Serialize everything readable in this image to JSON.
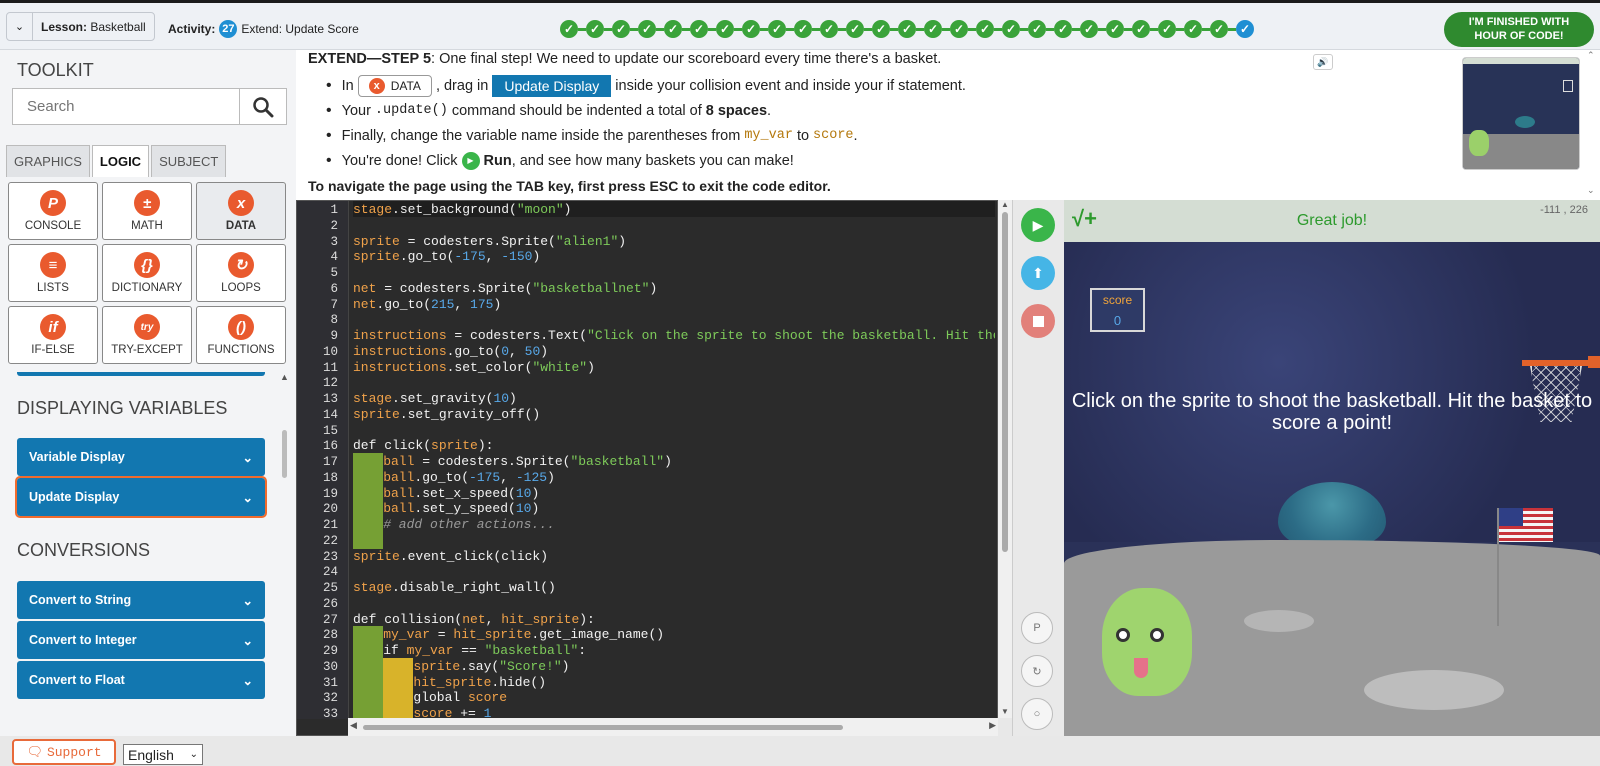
{
  "topbar": {
    "lesson_label": "Lesson:",
    "lesson_value": "Basketball",
    "activity_label": "Activity:",
    "activity_number": "27",
    "activity_title": "Extend: Update Score",
    "progress_completed": 26,
    "progress_current": 27,
    "finish_line1": "I'M FINISHED WITH",
    "finish_line2": "HOUR OF CODE!"
  },
  "toolkit": {
    "title": "TOOLKIT",
    "search_placeholder": "Search",
    "tabs": [
      "GRAPHICS",
      "LOGIC",
      "SUBJECT"
    ],
    "active_tab": "LOGIC",
    "categories": [
      {
        "label": "CONSOLE",
        "glyph": "P",
        "icon": "console-icon"
      },
      {
        "label": "MATH",
        "glyph": "±",
        "icon": "math-icon"
      },
      {
        "label": "DATA",
        "glyph": "x",
        "icon": "data-icon"
      },
      {
        "label": "LISTS",
        "glyph": "≡",
        "icon": "lists-icon"
      },
      {
        "label": "DICTIONARY",
        "glyph": "{}",
        "icon": "dictionary-icon"
      },
      {
        "label": "LOOPS",
        "glyph": "↻",
        "icon": "loops-icon"
      },
      {
        "label": "IF-ELSE",
        "glyph": "if",
        "icon": "if-else-icon"
      },
      {
        "label": "TRY-EXCEPT",
        "glyph": "try",
        "icon": "try-except-icon"
      },
      {
        "label": "FUNCTIONS",
        "glyph": "()",
        "icon": "functions-icon"
      }
    ],
    "active_category": "DATA",
    "section_displaying": "DISPLAYING VARIABLES",
    "block_variable_display": "Variable Display",
    "block_update_display": "Update Display",
    "section_conversions": "CONVERSIONS",
    "block_convert_string": "Convert to String",
    "block_convert_integer": "Convert to Integer",
    "block_convert_float": "Convert to Float"
  },
  "instructions": {
    "heading_bold": "EXTEND—STEP 5",
    "heading_rest": ": One final step! We need to update our scoreboard every time there's a basket.",
    "b1_pre": "In",
    "b1_chip": "DATA",
    "b1_mid": ", drag in",
    "b1_button": "Update Display",
    "b1_post": "inside your collision event and inside your if statement.",
    "b2_pre": "Your",
    "b2_code": ".update()",
    "b2_mid": "command should be indented a total of",
    "b2_bold": "8 spaces",
    "b2_post": ".",
    "b3_pre": "Finally, change the variable name inside the parentheses from",
    "b3_code1": "my_var",
    "b3_mid": "to",
    "b3_code2": "score",
    "b3_post": ".",
    "b4_pre": "You're done! Click",
    "b4_bold": "Run",
    "b4_post": ", and see how many baskets you can make!",
    "nav_note": "To navigate the page using the TAB key, first press ESC to exit the code editor."
  },
  "editor": {
    "lines": [
      "stage.set_background(\"moon\")",
      "",
      "sprite = codesters.Sprite(\"alien1\")",
      "sprite.go_to(-175, -150)",
      "",
      "net = codesters.Sprite(\"basketballnet\")",
      "net.go_to(215, 175)",
      "",
      "instructions = codesters.Text(\"Click on the sprite to shoot the basketball. Hit the",
      "instructions.go_to(0, 50)",
      "instructions.set_color(\"white\")",
      "",
      "stage.set_gravity(10)",
      "sprite.set_gravity_off()",
      "",
      "def click(sprite):",
      "    ball = codesters.Sprite(\"basketball\")",
      "    ball.go_to(-175, -125)",
      "    ball.set_x_speed(10)",
      "    ball.set_y_speed(10)",
      "    # add other actions...",
      "",
      "sprite.event_click(click)",
      "",
      "stage.disable_right_wall()",
      "",
      "def collision(net, hit_sprite):",
      "    my_var = hit_sprite.get_image_name()",
      "    if my_var == \"basketball\":",
      "        sprite.say(\"Score!\")",
      "        hit_sprite.hide()",
      "        global score",
      "        score += 1"
    ]
  },
  "stage": {
    "header": "Great job!",
    "check_glyph": "√+",
    "coords": "-111 , 226",
    "score_label": "score",
    "score_value": "0",
    "message": "Click on the sprite to shoot the basketball. Hit the basket to score a point!"
  },
  "controls": {
    "small_p": "P"
  },
  "footer": {
    "support": "Support",
    "language": "English"
  },
  "colors": {
    "accent_green": "#3aa33a",
    "brand_blue": "#1277b0",
    "orange": "#e95a2e"
  }
}
